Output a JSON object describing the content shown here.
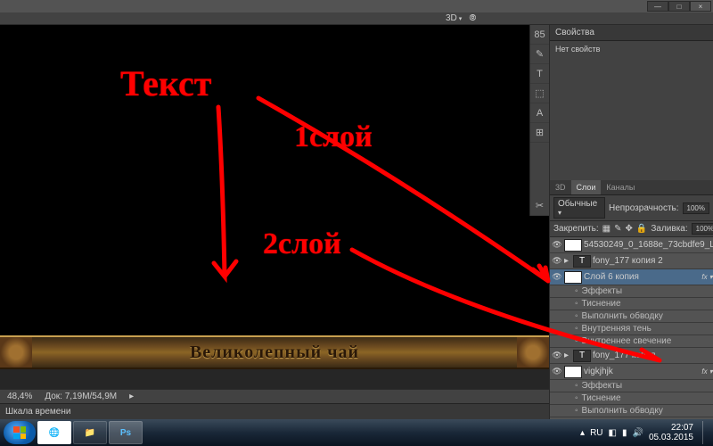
{
  "window": {
    "btn_min": "—",
    "btn_max": "□",
    "btn_close": "×"
  },
  "toolbar3d": {
    "label": "3D",
    "camera": "⦾"
  },
  "rtools": {
    "items": [
      "85",
      "✎",
      "T",
      "⬚",
      "A",
      "⊞",
      "✂"
    ]
  },
  "props": {
    "tab": "Свойства",
    "body": "Нет свойств"
  },
  "layers": {
    "tabs": {
      "t3d": "3D",
      "layers": "Слои",
      "channels": "Каналы"
    },
    "mode": "Обычные",
    "opacity_lbl": "Непрозрачность:",
    "opacity": "100%",
    "lock_lbl": "Закрепить:",
    "fill_lbl": "Заливка:",
    "fill": "100%",
    "items": [
      {
        "name": "54530249_0_1688e_73cbdfe9_L",
        "thumb": "light",
        "eye": true
      },
      {
        "name": "fony_177 копия 2",
        "thumb": "dark",
        "eye": true,
        "type": "T"
      },
      {
        "name": "Слой 6 копия",
        "thumb": "light",
        "eye": true,
        "selected": true,
        "fx": true
      },
      {
        "name": "fony_177 копия",
        "thumb": "dark",
        "eye": true,
        "type": "T"
      },
      {
        "name": "vigkjhjk",
        "thumb": "light",
        "eye": true,
        "fx": true
      }
    ],
    "fx_label": "Эффекты",
    "fx_items": [
      "Тиснение",
      "Выполнить обводку",
      "Внутренняя тень",
      "Внутреннее свечение"
    ],
    "fx_items2": [
      "Тиснение",
      "Выполнить обводку"
    ]
  },
  "canvas": {
    "banner_text": "Великолепный чай"
  },
  "status": {
    "zoom": "48,4%",
    "doc": "Док: 7,19M/54,9M"
  },
  "timeline": {
    "tab": "Шкала времени"
  },
  "annotations": {
    "text": "Текст",
    "layer1": "1слой",
    "layer2": "2слой"
  },
  "taskbar": {
    "icons": [
      {
        "name": "chrome",
        "glyph": "🌐",
        "bg": "#fff"
      },
      {
        "name": "explorer",
        "glyph": "📁"
      },
      {
        "name": "photoshop",
        "glyph": "Ps",
        "bg": "#001d33",
        "active": true
      }
    ],
    "lang": "RU",
    "time": "22:07",
    "date": "05.03.2015"
  }
}
